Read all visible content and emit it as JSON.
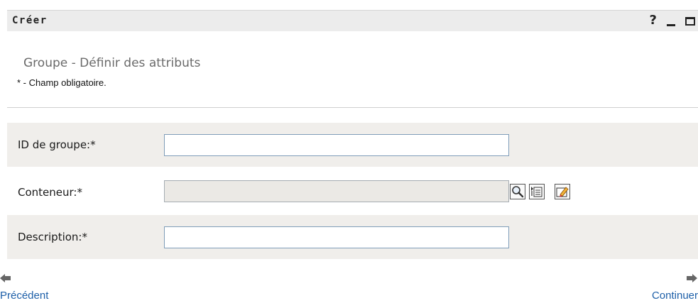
{
  "window": {
    "title": "Créer",
    "help_label": "?",
    "minimize_label": "minimize",
    "maximize_label": "maximize"
  },
  "header": {
    "subtitle": "Groupe - Définir des attributs",
    "required_note": "* - Champ obligatoire."
  },
  "form": {
    "fields": [
      {
        "label": "ID de groupe:*",
        "value": "",
        "placeholder": ""
      },
      {
        "label": "Conteneur:*",
        "value": "",
        "placeholder": ""
      },
      {
        "label": "Description:*",
        "value": "",
        "placeholder": ""
      }
    ],
    "container_actions": [
      {
        "icon": "magnifier-search-icon"
      },
      {
        "icon": "object-history-icon"
      },
      {
        "icon": "clear-eraser-icon"
      }
    ]
  },
  "navigation": {
    "back_label": "Précédent",
    "next_label": "Continuer",
    "back_icon": "arrow-left-icon",
    "next_icon": "arrow-right-icon"
  },
  "colors": {
    "title_bar": "#ececec",
    "row_shade": "#f0eeeb",
    "link": "#1d5fa8",
    "input_border": "#7f9db9",
    "readonly_input": "#ebe9e5"
  }
}
